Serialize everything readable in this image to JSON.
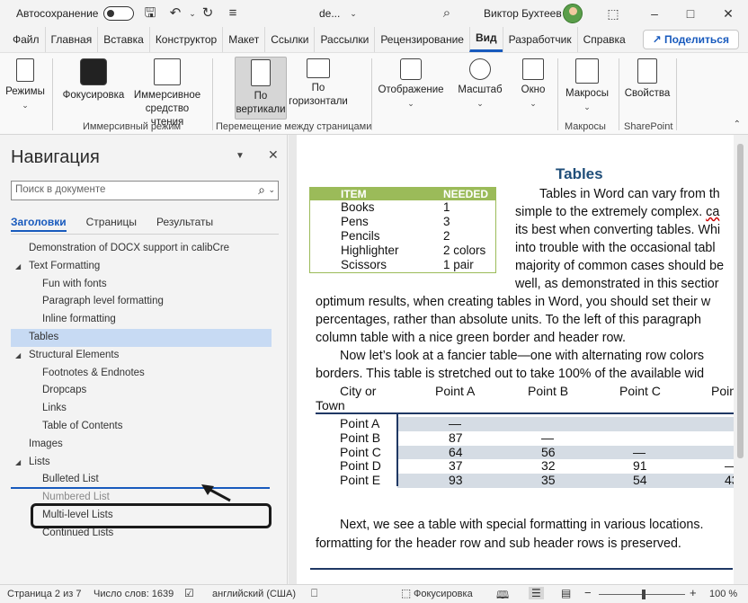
{
  "titlebar": {
    "autosave_label": "Автосохранение",
    "doc_title": "de...",
    "username": "Виктор Бухтеев"
  },
  "menu": {
    "tabs": [
      "Файл",
      "Главная",
      "Вставка",
      "Конструктор",
      "Макет",
      "Ссылки",
      "Рассылки",
      "Рецензирование",
      "Вид",
      "Разработчик",
      "Справка"
    ],
    "active_tab": "Вид",
    "share_label": "Поделиться"
  },
  "ribbon": {
    "buttons": {
      "modes": "Режимы",
      "focus": "Фокусировка",
      "immersive_reader": "Иммерсивное средство чтения",
      "vertical": "По вертикали",
      "horizontal": "По горизонтали",
      "show": "Отображение",
      "zoom": "Масштаб",
      "window": "Окно",
      "macros": "Макросы",
      "properties": "Свойства"
    },
    "groups": {
      "immersive": "Иммерсивный режим",
      "page_movement": "Перемещение между страницами",
      "macros": "Макросы",
      "sharepoint": "SharePoint"
    }
  },
  "nav": {
    "title": "Навигация",
    "search_placeholder": "Поиск в документе",
    "tabs": [
      "Заголовки",
      "Страницы",
      "Результаты"
    ],
    "active_tab": "Заголовки",
    "items": [
      {
        "label": "Demonstration of DOCX support in calibCre",
        "level": 0,
        "expandable": false
      },
      {
        "label": "Text Formatting",
        "level": 0,
        "expandable": true
      },
      {
        "label": "Fun with fonts",
        "level": 1,
        "expandable": false
      },
      {
        "label": "Paragraph level formatting",
        "level": 1,
        "expandable": false
      },
      {
        "label": "Inline formatting",
        "level": 1,
        "expandable": false
      },
      {
        "label": "Tables",
        "level": 0,
        "expandable": false,
        "selected": true
      },
      {
        "label": "Structural Elements",
        "level": 0,
        "expandable": true
      },
      {
        "label": "Footnotes & Endnotes",
        "level": 1,
        "expandable": false
      },
      {
        "label": "Dropcaps",
        "level": 1,
        "expandable": false
      },
      {
        "label": "Links",
        "level": 1,
        "expandable": false
      },
      {
        "label": "Table of Contents",
        "level": 1,
        "expandable": false
      },
      {
        "label": "Images",
        "level": 0,
        "expandable": false
      },
      {
        "label": "Lists",
        "level": 0,
        "expandable": true
      },
      {
        "label": "Bulleted List",
        "level": 1,
        "expandable": false
      },
      {
        "label": "Numbered List",
        "level": 1,
        "expandable": false
      },
      {
        "label": "Multi-level Lists",
        "level": 1,
        "expandable": false
      },
      {
        "label": "Continued Lists",
        "level": 1,
        "expandable": false
      }
    ]
  },
  "document": {
    "heading": "Tables",
    "green_table": {
      "headers": [
        "ITEM",
        "NEEDED"
      ],
      "rows": [
        [
          "Books",
          "1"
        ],
        [
          "Pens",
          "3"
        ],
        [
          "Pencils",
          "2"
        ],
        [
          "Highlighter",
          "2 colors"
        ],
        [
          "Scissors",
          "1 pair"
        ]
      ]
    },
    "side_lines": [
      "Tables in Word can vary from th",
      "simple to the extremely complex.",
      "its best when converting tables. Whi",
      "into trouble with the occasional tabl",
      "majority of common cases should be",
      "well, as demonstrated in this sectior"
    ],
    "squiggle_word": "ca",
    "full_lines": [
      "optimum results, when creating tables in Word, you should set their w",
      "percentages, rather than absolute units.  To the left of this paragraph",
      "column table with a nice green border and header row."
    ],
    "para2_lines": [
      "Now let’s look at a fancier table—one with alternating row colors",
      "borders. This table is stretched out to take 100% of the available wid"
    ],
    "points_table": {
      "headers": [
        "City or Town",
        "Point A",
        "Point B",
        "Point C",
        "Poin"
      ],
      "rows": [
        [
          "Point A",
          "—",
          "",
          "",
          ""
        ],
        [
          "Point B",
          "87",
          "—",
          "",
          ""
        ],
        [
          "Point C",
          "64",
          "56",
          "—",
          ""
        ],
        [
          "Point D",
          "37",
          "32",
          "91",
          "—"
        ],
        [
          "Point E",
          "93",
          "35",
          "54",
          "43"
        ]
      ]
    },
    "para3_lines": [
      "Next, we see a table with special formatting in various locations.",
      "formatting for the header row and sub header rows is preserved."
    ]
  },
  "status": {
    "page": "Страница 2 из 7",
    "words": "Число слов: 1639",
    "language": "английский (США)",
    "focus": "Фокусировка",
    "zoom_level": "100 %",
    "zoom_fraction": 0.5
  }
}
